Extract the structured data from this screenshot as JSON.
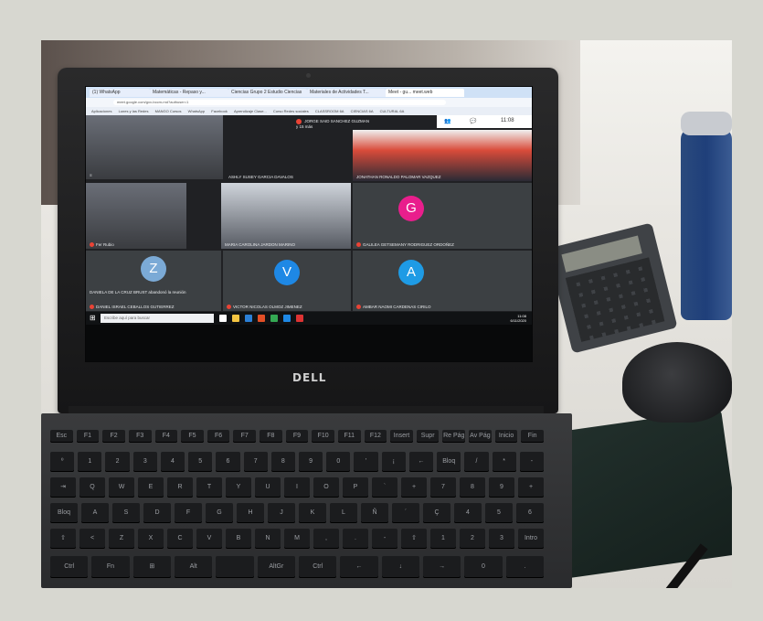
{
  "browser": {
    "tabs": [
      {
        "title": "(1) WhatsApp"
      },
      {
        "title": "Matemáticas - Repaso y..."
      },
      {
        "title": "Ciencias Grupo 2 Estudio Ciencias"
      },
      {
        "title": "Materiales de Actividades T..."
      },
      {
        "title": "Meet - gu... meet.web"
      }
    ],
    "url": "meet.google.com/gxx-bccm-rnd?authuser=1",
    "bookmarks": [
      "Aplicaciones",
      "Lunes y las Redes",
      "MANGO Cursos",
      "WhatsApp",
      "Facebook",
      "Aprendizaje Clase...",
      "Curso Redes sociales",
      "CLASSROOM 6A",
      "CIENCIAS 6A",
      "CULTURAL 6A"
    ]
  },
  "meet": {
    "top_chip": "JORGE SAID SANCHEZ GUZMAN",
    "top_chip_sub": "y 15 más",
    "time": "11:08",
    "participants": [
      {
        "name": "ASHLY SUSEY GARCIA DAVALOS"
      },
      {
        "name": "JONATHAN RONALDO PALOMAR VAZQUEZ"
      },
      {
        "name": "Fer Rubio"
      },
      {
        "name": "MARIA CAROLINA JARDON MARINO"
      },
      {
        "name": "GALILEA GETSEMANY RODRIGUEZ ORDOÑEZ",
        "initial": "G"
      },
      {
        "name": "DANIELA DE LA CRUZ BRUST abandonó la reunión",
        "initial": "Z"
      },
      {
        "name": "DANIEL ISRAEL CEBALLOS GUTIERREZ"
      },
      {
        "name": "VICTOR NICOLAS OLMOZ JIMENEZ",
        "initial": "V"
      },
      {
        "name": "AMBAR NAOMI CARDENAS CIRILO",
        "initial": "A"
      }
    ]
  },
  "taskbar": {
    "search_placeholder": "Escribe aquí para buscar",
    "time": "11:08",
    "date": "6/11/2020"
  },
  "laptop": {
    "brand": "DELL"
  },
  "keyboard": {
    "row1": [
      "Esc",
      "F1",
      "F2",
      "F3",
      "F4",
      "F5",
      "F6",
      "F7",
      "F8",
      "F9",
      "F10",
      "F11",
      "F12",
      "Insert",
      "Supr",
      "Re Pág",
      "Av Pág",
      "Inicio",
      "Fin"
    ],
    "row2": [
      "º",
      "1",
      "2",
      "3",
      "4",
      "5",
      "6",
      "7",
      "8",
      "9",
      "0",
      "'",
      "¡",
      "←",
      "Bloq Num",
      "/",
      "*",
      "-"
    ],
    "row3": [
      "⇥",
      "Q",
      "W",
      "E",
      "R",
      "T",
      "Y",
      "U",
      "I",
      "O",
      "P",
      "`",
      "+",
      "7",
      "8",
      "9",
      "+"
    ],
    "row4": [
      "Bloq Mayús",
      "A",
      "S",
      "D",
      "F",
      "G",
      "H",
      "J",
      "K",
      "L",
      "Ñ",
      "´",
      "Ç",
      "4",
      "5",
      "6"
    ],
    "row5": [
      "⇧",
      "<",
      "Z",
      "X",
      "C",
      "V",
      "B",
      "N",
      "M",
      ",",
      ".",
      "-",
      "⇧",
      "1",
      "2",
      "3",
      "Intro"
    ],
    "row6": [
      "Ctrl",
      "Fn",
      "⊞",
      "Alt",
      "",
      "AltGr",
      "Ctrl",
      "←",
      "↓",
      "→",
      "0",
      "."
    ]
  },
  "colors": {
    "meet_bg": "#202124",
    "avatar_g": "#e91e8c",
    "avatar_v": "#1e88e5",
    "avatar_a": "#1e9be5",
    "avatar_z": "#7baad6"
  }
}
